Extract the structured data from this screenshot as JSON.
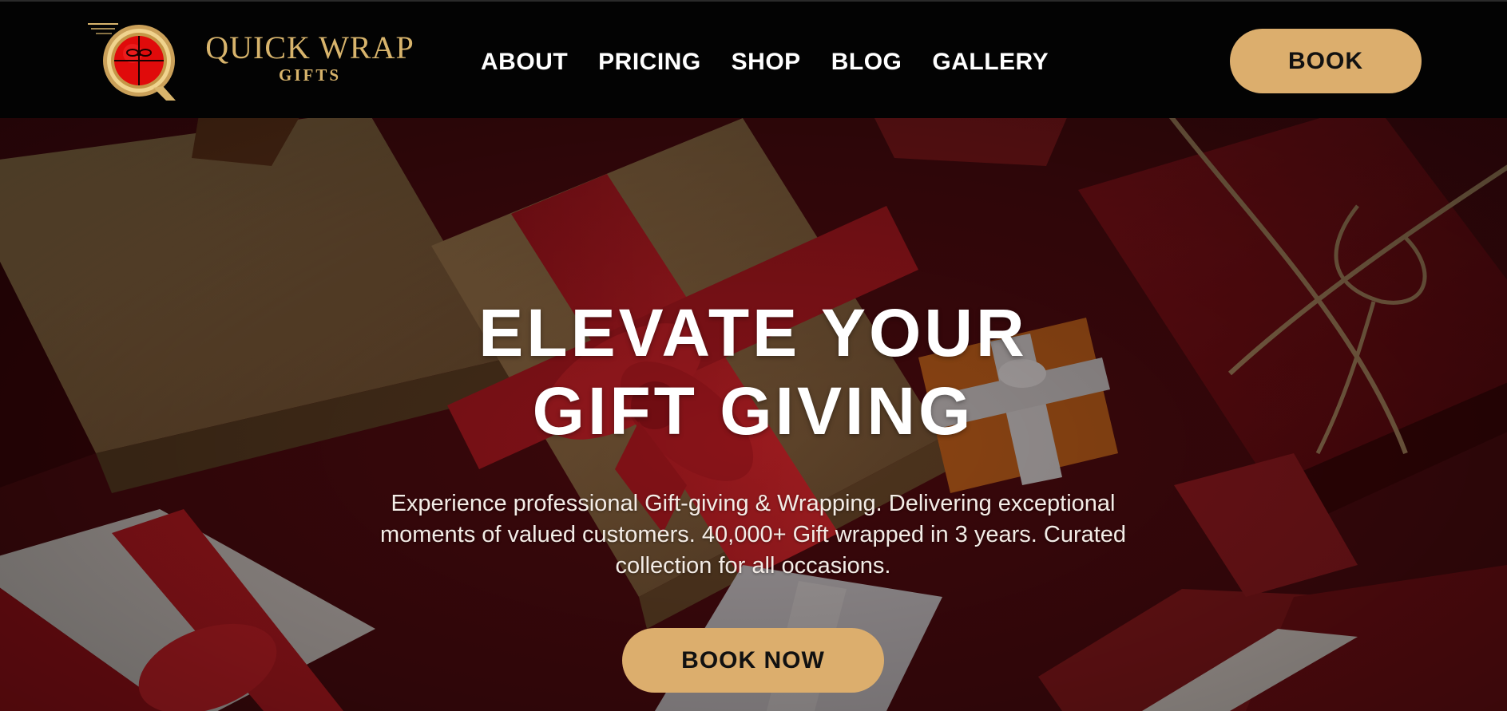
{
  "brand": {
    "name_line1": "QUICK WRAP",
    "name_line2": "GIFTS",
    "logo_icon": "gift-q-logo-icon",
    "gold_color": "#d8b46c",
    "red_color": "#e00b0b"
  },
  "nav": {
    "links": [
      "ABOUT",
      "PRICING",
      "SHOP",
      "BLOG",
      "GALLERY"
    ],
    "book_label": "BOOK"
  },
  "hero": {
    "title": "ELEVATE YOUR GIFT GIVING",
    "description": "Experience professional Gift-giving & Wrapping. Delivering exceptional moments of valued customers. 40,000+ Gift wrapped in 3 years. Curated collection for all occasions.",
    "cta_label": "BOOK NOW",
    "background": "gift-boxes-photo"
  },
  "colors": {
    "nav_bg": "#030303",
    "button_bg": "#dcae6d",
    "hero_tint": "#4d0b10"
  }
}
